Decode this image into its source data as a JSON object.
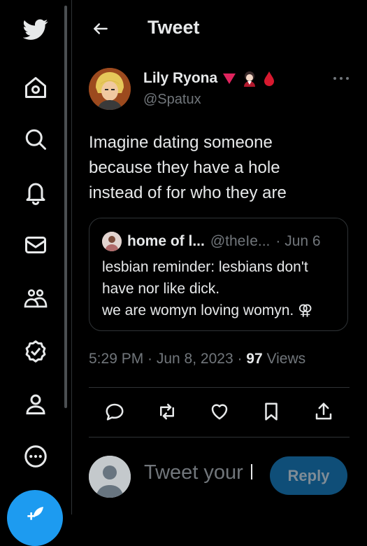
{
  "header": {
    "title": "Tweet"
  },
  "tweet": {
    "author_name": "Lily Ryona",
    "author_handle": "@Spatux",
    "text": "Imagine dating someone\nbecause they have a hole\ninstead of for who they are",
    "time": "5:29 PM · Jun 8, 2023 · ",
    "views_count": "97",
    "views_label": " Views"
  },
  "quoted_tweet": {
    "name": "home of l...",
    "handle": "@theIe...",
    "date": "· Jun 6",
    "text": "lesbian reminder: lesbians don't\nhave nor like dick.\nwe are womyn loving womyn. ⚢"
  },
  "reply": {
    "placeholder": "Tweet your",
    "button_label": "Reply"
  },
  "colors": {
    "background": "#000000",
    "accent": "#1d9bf0",
    "secondary_text": "#71767b"
  },
  "icons": {
    "sidebar": [
      "twitter-bird-icon",
      "home-icon",
      "search-icon",
      "bell-icon",
      "mail-icon",
      "communities-icon",
      "verified-icon",
      "profile-icon",
      "more-circle-icon",
      "compose-icon"
    ],
    "actions": [
      "reply-icon",
      "retweet-icon",
      "like-icon",
      "bookmark-icon",
      "share-icon"
    ]
  }
}
